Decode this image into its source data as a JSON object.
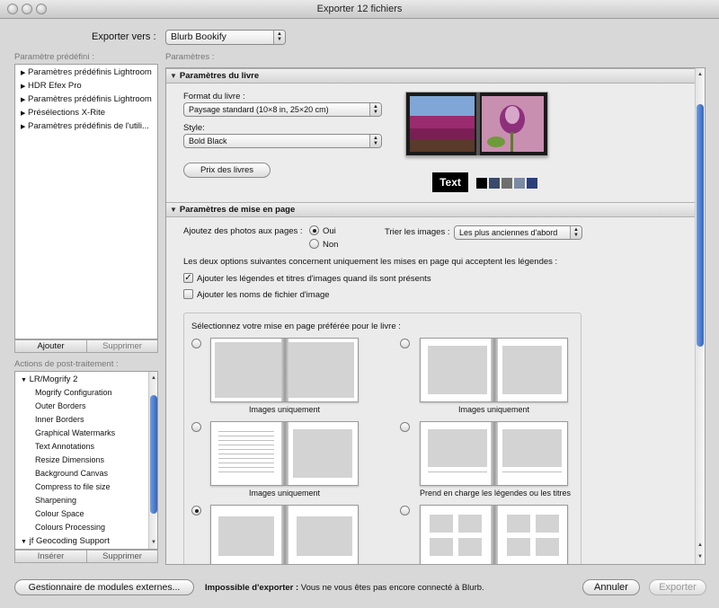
{
  "window": {
    "title": "Exporter 12 fichiers"
  },
  "export_to": {
    "label": "Exporter vers :",
    "value": "Blurb Bookify"
  },
  "presets": {
    "header": "Paramètre prédéfini :",
    "items": [
      "Paramètres prédéfinis Lightroom",
      "HDR Efex Pro",
      "Paramètres prédéfinis Lightroom",
      "Présélections X-Rite",
      "Paramètres prédéfinis de l'utili..."
    ],
    "add_button": "Ajouter",
    "remove_button": "Supprimer"
  },
  "post_process": {
    "header": "Actions de post-traitement :",
    "group1": "LR/Mogrify 2",
    "items": [
      "Mogrify Configuration",
      "Outer Borders",
      "Inner Borders",
      "Graphical Watermarks",
      "Text Annotations",
      "Resize Dimensions",
      "Background Canvas",
      "Compress to file size",
      "Sharpening",
      "Colour Space",
      "Colours Processing"
    ],
    "group2": "jf Geocoding Support",
    "insert_button": "Insérer",
    "remove_button": "Supprimer"
  },
  "params_header": "Paramètres :",
  "book_settings": {
    "title": "Paramètres du livre",
    "format_label": "Format du livre :",
    "format_value": "Paysage standard (10×8 in, 25×20 cm)",
    "style_label": "Style:",
    "style_value": "Bold Black",
    "price_button": "Prix des livres",
    "text_badge": "Text",
    "swatches": [
      "#000000",
      "#3a4a6b",
      "#6f6f6f",
      "#7a8ba3",
      "#2a3f7a"
    ]
  },
  "layout_settings": {
    "title": "Paramètres de mise en page",
    "add_photos_label": "Ajoutez des photos aux pages :",
    "yes": "Oui",
    "no": "Non",
    "sort_label": "Trier les images :",
    "sort_value": "Les plus anciennes d'abord",
    "note": "Les deux options suivantes concernent uniquement les mises en page qui acceptent les légendes :",
    "check1": "Ajouter les légendes et titres d'images quand ils sont présents",
    "check2": "Ajouter les noms de fichier d'image",
    "choose_label": "Sélectionnez votre mise en page préférée pour le livre :",
    "cap1": "Images uniquement",
    "cap2": "Images uniquement",
    "cap3": "Images uniquement",
    "cap4": "Prend en charge les légendes ou les titres"
  },
  "footer": {
    "plugin_button": "Gestionnaire de modules externes...",
    "error_bold": "Impossible d'exporter :",
    "error_text": "Vous ne vous êtes pas encore connecté à Blurb.",
    "cancel_button": "Annuler",
    "export_button": "Exporter"
  }
}
